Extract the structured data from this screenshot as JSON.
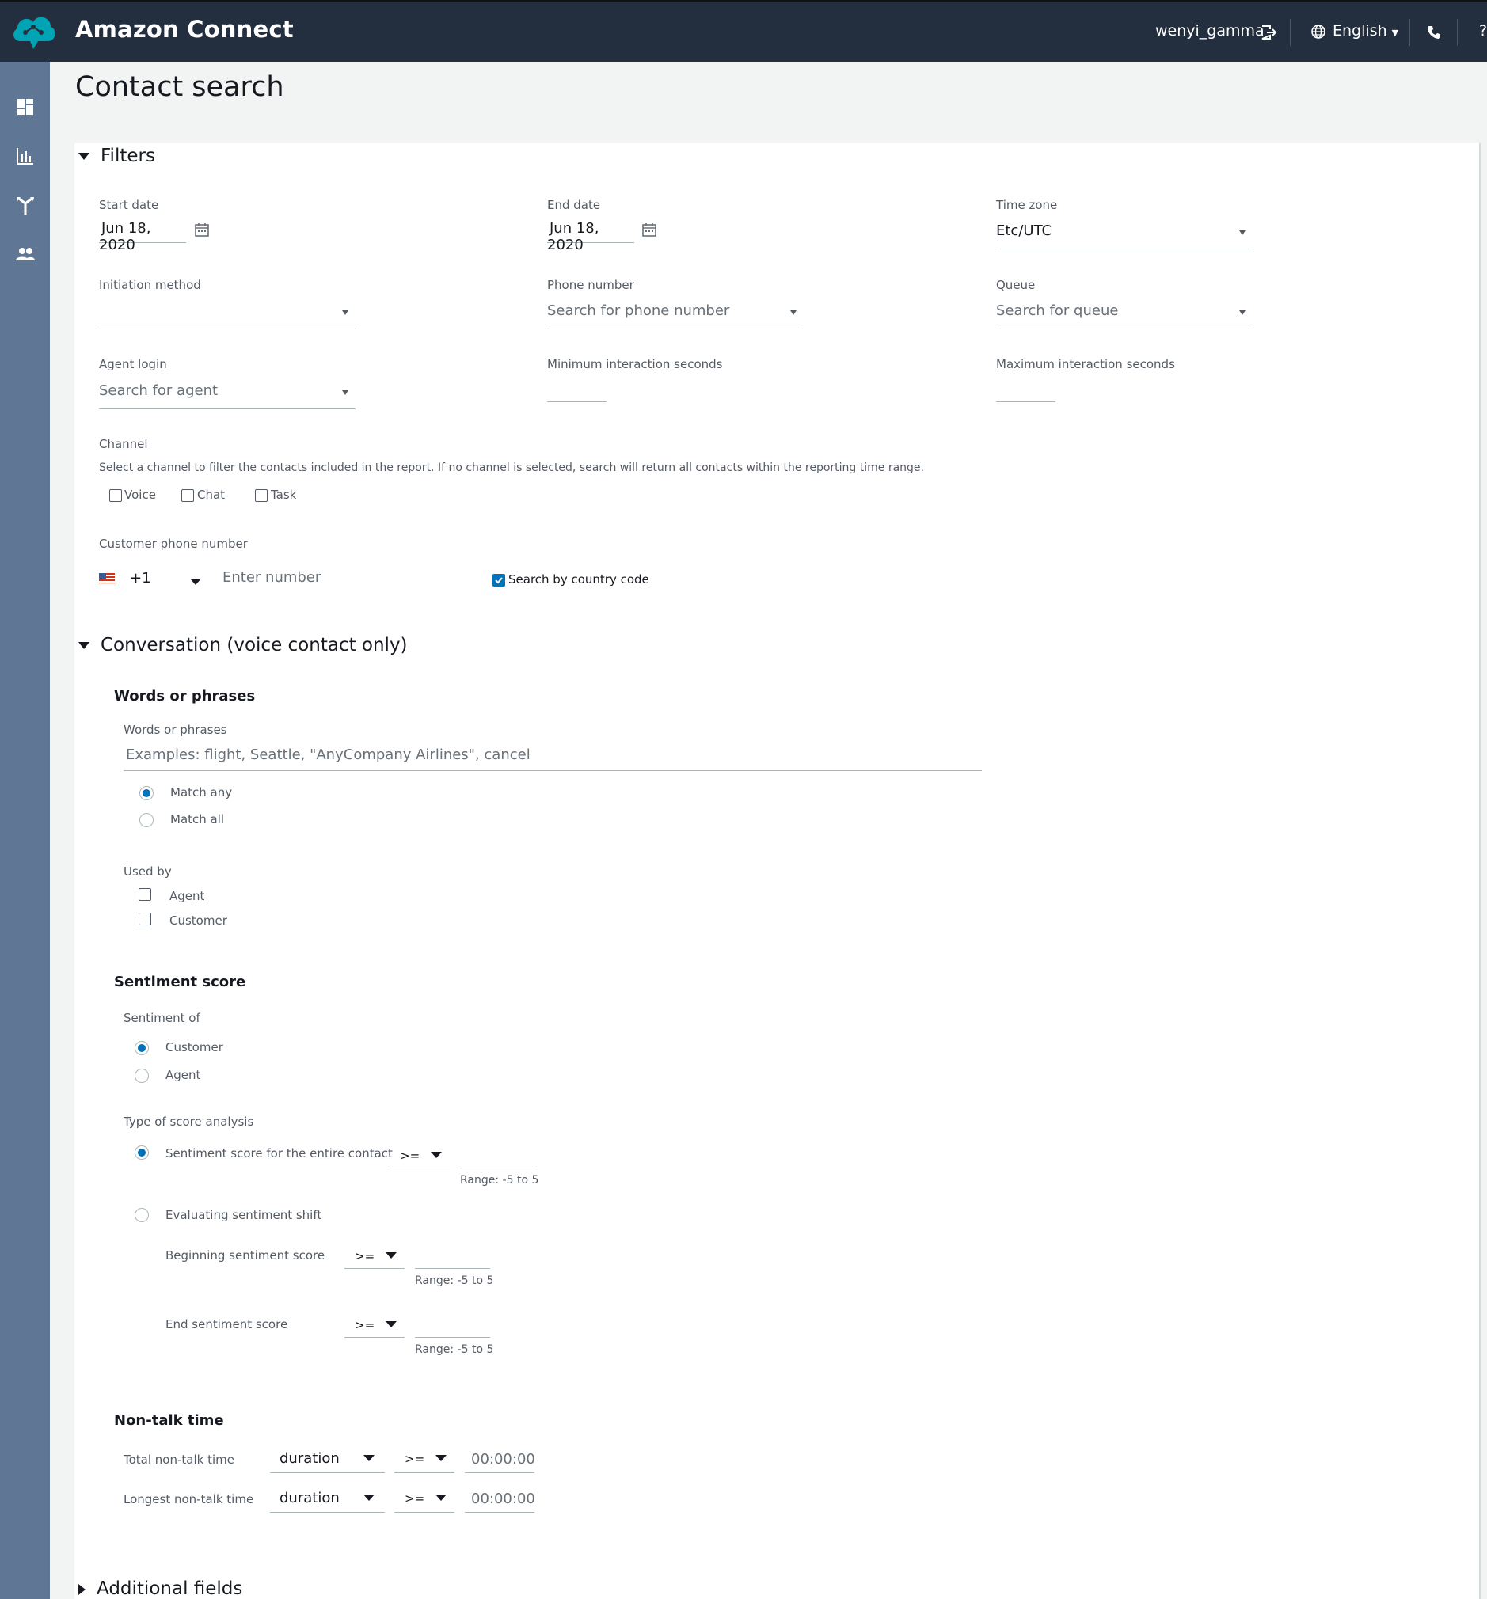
{
  "app": {
    "brand": "Amazon Connect",
    "user": "wenyi_gamma",
    "language": "English"
  },
  "page": {
    "title": "Contact search"
  },
  "filters": {
    "section_label": "Filters",
    "start_date": {
      "label": "Start date",
      "value": "Jun 18, 2020"
    },
    "end_date": {
      "label": "End date",
      "value": "Jun 18, 2020"
    },
    "time_zone": {
      "label": "Time zone",
      "value": "Etc/UTC"
    },
    "initiation_method": {
      "label": "Initiation method",
      "value": ""
    },
    "phone_number": {
      "label": "Phone number",
      "placeholder": "Search for phone number"
    },
    "queue": {
      "label": "Queue",
      "placeholder": "Search for queue"
    },
    "agent_login": {
      "label": "Agent login",
      "placeholder": "Search for agent"
    },
    "min_seconds": {
      "label": "Minimum interaction seconds"
    },
    "max_seconds": {
      "label": "Maximum interaction seconds"
    },
    "channel": {
      "label": "Channel",
      "help": "Select a channel to filter the contacts included in the report. If no channel is selected, search will return all contacts within the reporting time range.",
      "options": [
        "Voice",
        "Chat",
        "Task"
      ]
    },
    "customer_phone": {
      "label": "Customer phone number",
      "country_code": "+1",
      "placeholder": "Enter number",
      "search_by_country_code": "Search by country code"
    }
  },
  "conversation": {
    "section_label": "Conversation (voice contact only)",
    "words": {
      "heading": "Words or phrases",
      "label": "Words or phrases",
      "placeholder": "Examples: flight, Seattle, \"AnyCompany Airlines\", cancel",
      "match_any": "Match any",
      "match_all": "Match all",
      "used_by_label": "Used by",
      "used_by_options": [
        "Agent",
        "Customer"
      ]
    },
    "sentiment": {
      "heading": "Sentiment score",
      "of_label": "Sentiment of",
      "of_customer": "Customer",
      "of_agent": "Agent",
      "analysis_label": "Type of score analysis",
      "entire_contact": "Sentiment score for the entire contact",
      "operator": ">=",
      "range": "Range: -5 to 5",
      "shift": "Evaluating sentiment shift",
      "beginning": "Beginning sentiment score",
      "end": "End sentiment score"
    },
    "non_talk": {
      "heading": "Non-talk time",
      "total": "Total non-talk time",
      "longest": "Longest non-talk time",
      "unit": "duration",
      "operator": ">=",
      "time_placeholder": "00:00:00"
    }
  },
  "additional": {
    "section_label": "Additional fields"
  }
}
